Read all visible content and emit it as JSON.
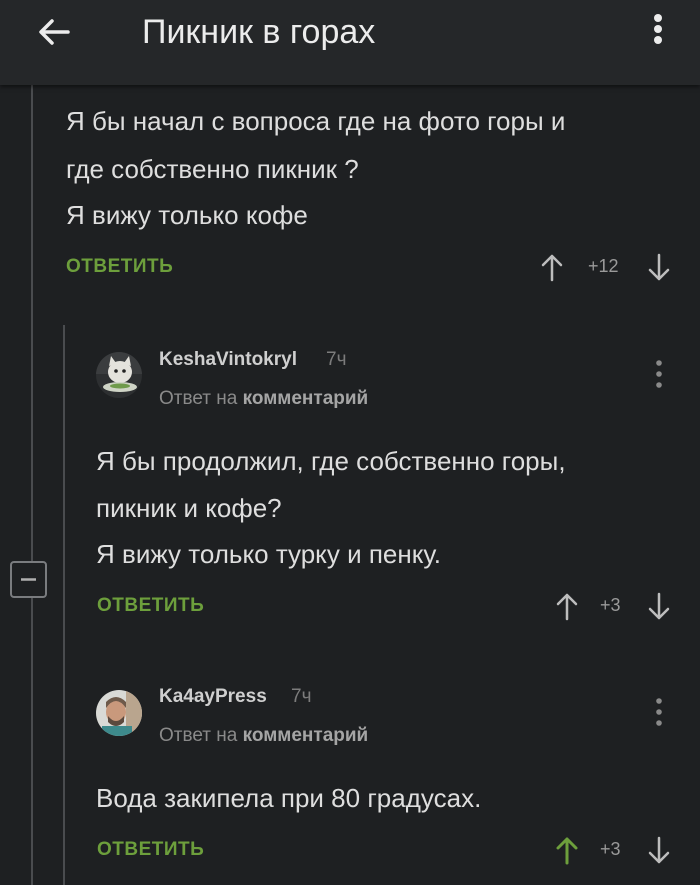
{
  "header": {
    "title": "Пикник в горах",
    "back_icon": "arrow-left-icon",
    "menu_icon": "kebab-menu-icon"
  },
  "colors": {
    "background": "#1e2022",
    "topbar": "#252729",
    "accent_green": "#6d9f3c",
    "text": "#dedede"
  },
  "comments": [
    {
      "lines": [
        "Я бы начал с вопроса где на фото горы и",
        "где собственно пикник ?",
        "Я вижу только кофе"
      ],
      "reply_label": "ОТВЕТИТЬ",
      "votes": "+12"
    },
    {
      "author": "KeshaVintokryl",
      "time": "7ч",
      "reply_prefix": "Ответ на",
      "reply_target": "комментарий",
      "lines": [
        "Я бы продолжил, где собственно горы,",
        "пикник и кофе?",
        "Я вижу только турку и пенку."
      ],
      "reply_label": "ОТВЕТИТЬ",
      "votes": "+3"
    },
    {
      "author": "Ka4ayPress",
      "time": "7ч",
      "reply_prefix": "Ответ на",
      "reply_target": "комментарий",
      "lines": [
        "Вода закипела при 80 градусах."
      ],
      "reply_label": "ОТВЕТИТЬ",
      "votes": "+3",
      "upvoted": true
    }
  ]
}
